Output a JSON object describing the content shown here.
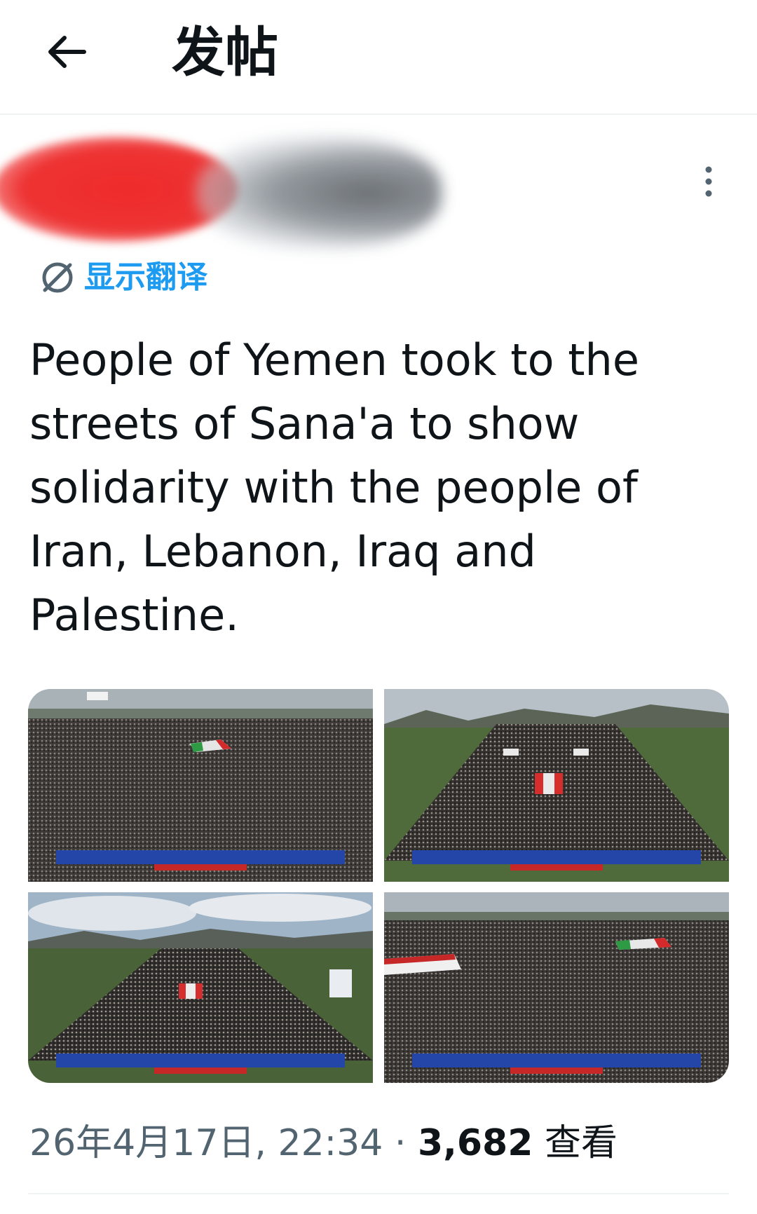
{
  "header": {
    "title": "发帖",
    "back_icon": "arrow-left-icon"
  },
  "author": {
    "redacted": true,
    "more_icon": "more-vertical-icon"
  },
  "translate": {
    "icon": "translate-icon",
    "label": "显示翻译"
  },
  "tweet": {
    "text": "People of Yemen took to the streets of Sana'a to show solidarity with the people of Iran, Lebanon, Iraq and Palestine."
  },
  "media": {
    "count": 4,
    "items": [
      {
        "kind": "photo",
        "subject": "crowd-rally"
      },
      {
        "kind": "photo",
        "subject": "crowd-rally-avenue"
      },
      {
        "kind": "photo",
        "subject": "crowd-rally-avenue-sky"
      },
      {
        "kind": "photo",
        "subject": "crowd-rally-flags"
      }
    ]
  },
  "meta": {
    "date_time": "26年4月17日, 22:34",
    "separator": "·",
    "views_count": "3,682",
    "views_label": "查看"
  },
  "colors": {
    "text_primary": "#0f1419",
    "text_secondary": "#536471",
    "accent": "#1d9bf0",
    "divider": "#eff3f4"
  }
}
